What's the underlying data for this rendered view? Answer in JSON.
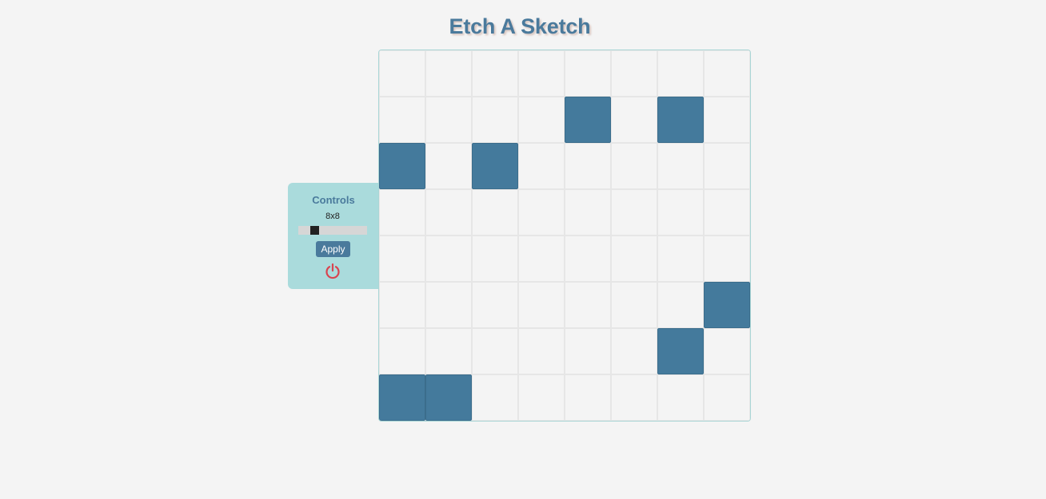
{
  "title": "Etch A Sketch",
  "controls": {
    "heading": "Controls",
    "size_label": "8x8",
    "slider_value": 8,
    "apply_label": "Apply",
    "power_icon": "power-icon"
  },
  "colors": {
    "accent": "#447a9c",
    "panel": "#aadbdc",
    "power": "#d9434f"
  },
  "grid": {
    "size": 8,
    "filled": [
      [
        1,
        4
      ],
      [
        1,
        6
      ],
      [
        2,
        0
      ],
      [
        2,
        2
      ],
      [
        5,
        7
      ],
      [
        6,
        6
      ],
      [
        7,
        0
      ],
      [
        7,
        1
      ]
    ]
  }
}
